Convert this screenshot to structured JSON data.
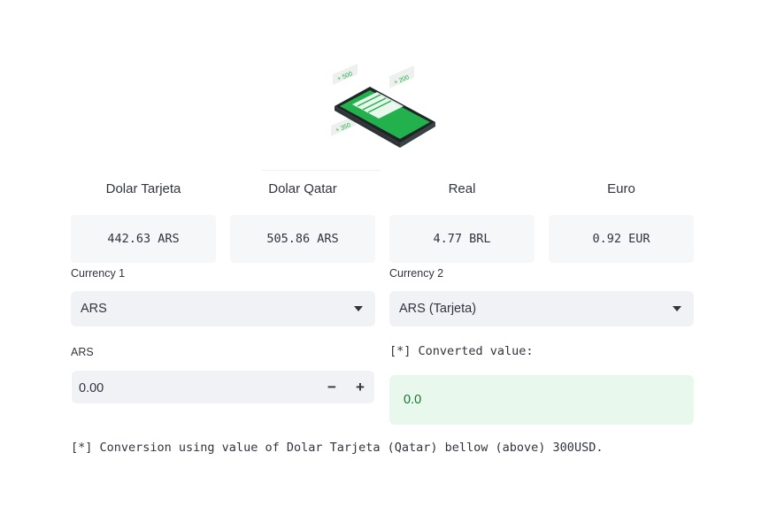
{
  "hero": {
    "tags": [
      "+ 500",
      "+ 200",
      "+ 350"
    ],
    "colors": {
      "green": "#22b14c",
      "phone": "#2e3436"
    }
  },
  "rates": [
    {
      "title": "Dolar Tarjeta",
      "value": "442.63 ARS"
    },
    {
      "title": "Dolar Qatar",
      "value": "505.86 ARS"
    },
    {
      "title": "Real",
      "value": "4.77 BRL"
    },
    {
      "title": "Euro",
      "value": "0.92 EUR"
    }
  ],
  "currency1": {
    "label": "Currency 1",
    "selected": "ARS"
  },
  "currency2": {
    "label": "Currency 2",
    "selected": "ARS (Tarjeta)"
  },
  "amount": {
    "label": "ARS",
    "value": "0.00",
    "decrement": "−",
    "increment": "+"
  },
  "converted": {
    "label": "[*] Converted value:",
    "value": "0.0"
  },
  "footnote": "[*] Conversion using value of Dolar Tarjeta (Qatar) bellow (above) 300USD.",
  "colors": {
    "input_bg": "#f0f2f6",
    "success_bg": "#e8f8ec",
    "success_text": "#177233",
    "text": "#31333f"
  }
}
